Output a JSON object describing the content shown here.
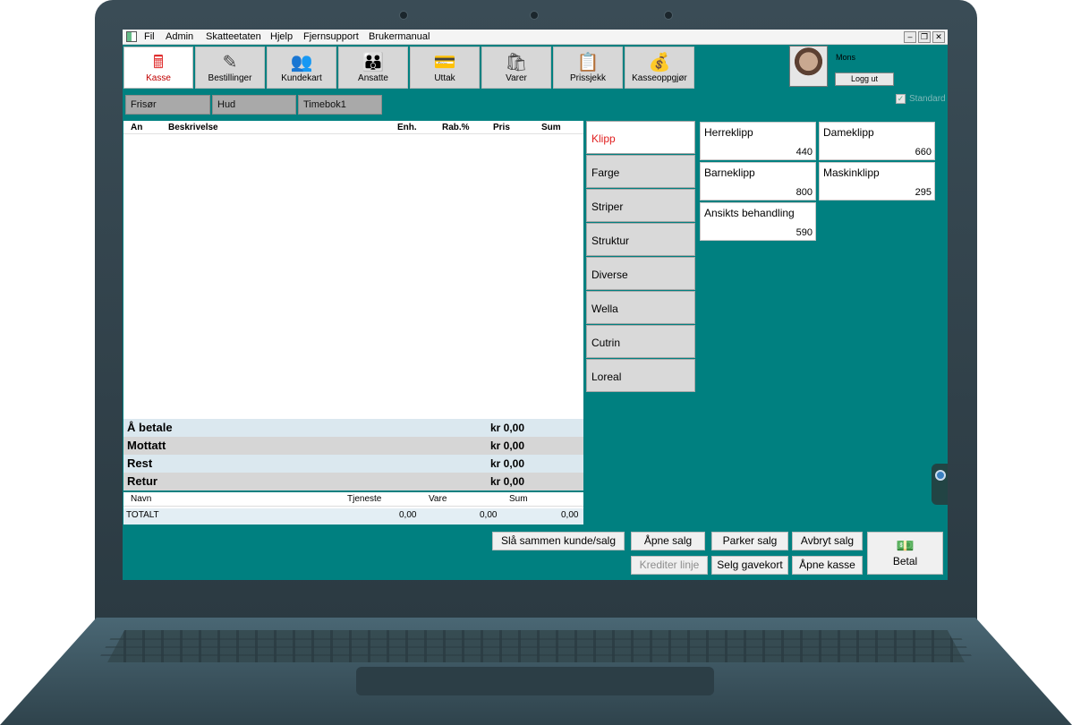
{
  "menu": [
    "Fil",
    "Admin",
    "Skatteetaten",
    "Hjelp",
    "Fjernsupport",
    "Brukermanual"
  ],
  "window_buttons": {
    "minimize": "–",
    "restore": "❐",
    "close": "✕"
  },
  "toolbar": [
    {
      "label": "Kasse",
      "icon": "cash-register-icon",
      "glyph": "🖩",
      "active": true
    },
    {
      "label": "Bestillinger",
      "icon": "pencil-notepad-icon",
      "glyph": "✎",
      "active": false
    },
    {
      "label": "Kundekart",
      "icon": "customers-icon",
      "glyph": "👥",
      "active": false
    },
    {
      "label": "Ansatte",
      "icon": "staff-group-icon",
      "glyph": "👪",
      "active": false
    },
    {
      "label": "Uttak",
      "icon": "withdrawal-card-icon",
      "glyph": "💳",
      "active": false
    },
    {
      "label": "Varer",
      "icon": "shopping-bags-icon",
      "glyph": "🛍",
      "active": false
    },
    {
      "label": "Prissjekk",
      "icon": "price-check-clipboard-icon",
      "glyph": "📋",
      "active": false
    },
    {
      "label": "Kasseoppgjør",
      "icon": "cash-settlement-icon",
      "glyph": "💰",
      "active": false
    }
  ],
  "user": {
    "name": "Mons",
    "logout_label": "Logg ut"
  },
  "tabs": [
    "Frisør",
    "Hud",
    "Timebok1"
  ],
  "standard_label": "Standard",
  "grid_columns": [
    "An",
    "Beskrivelse",
    "Enh.",
    "Rab.%",
    "Pris",
    "Sum"
  ],
  "totals": [
    {
      "label": "Å betale",
      "value": "kr 0,00",
      "bg": "#dbe8ef"
    },
    {
      "label": "Mottatt",
      "value": "kr 0,00",
      "bg": "#d6d6d6"
    },
    {
      "label": "Rest",
      "value": "kr 0,00",
      "bg": "#dbe8ef"
    },
    {
      "label": "Retur",
      "value": "kr 0,00",
      "bg": "#d6d6d6"
    }
  ],
  "summary": {
    "columns": [
      "Navn",
      "Tjeneste",
      "Vare",
      "Sum"
    ],
    "row": {
      "label": "TOTALT",
      "tjeneste": "0,00",
      "vare": "0,00",
      "sum": "0,00"
    }
  },
  "categories": [
    "Klipp",
    "Farge",
    "Striper",
    "Struktur",
    "Diverse",
    "Wella",
    "Cutrin",
    "Loreal"
  ],
  "products": [
    {
      "name": "Herreklipp",
      "price": "440"
    },
    {
      "name": "Dameklipp",
      "price": "660"
    },
    {
      "name": "Barneklipp",
      "price": "800"
    },
    {
      "name": "Maskinklipp",
      "price": "295"
    },
    {
      "name": "Ansikts behandling",
      "price": "590"
    }
  ],
  "buttons": {
    "merge": "Slå sammen kunde/salg",
    "open_sale": "Åpne salg",
    "park_sale": "Parker salg",
    "cancel_sale": "Avbryt salg",
    "credit_line": "Krediter linje",
    "sell_giftcard": "Selg gavekort",
    "open_register": "Åpne kasse",
    "pay": "Betal"
  }
}
